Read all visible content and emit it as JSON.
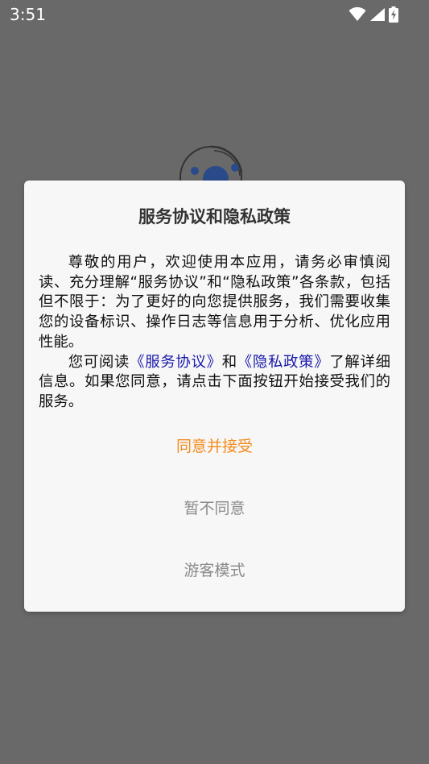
{
  "status_bar": {
    "time": "3:51",
    "icons": [
      "wifi-icon",
      "cellular-signal-icon",
      "battery-charging-icon"
    ]
  },
  "dialog": {
    "title": "服务协议和隐私政策",
    "paragraph1": "尊敬的用户，欢迎使用本应用，请务必审慎阅读、充分理解“服务协议”和“隐私政策”各条款，包括但不限于：为了更好的向您提供服务，我们需要收集您的设备标识、操作日志等信息用于分析、优化应用性能。",
    "paragraph2": {
      "prefix": "您可阅读",
      "service_link": "《服务协议》",
      "middle": "和",
      "privacy_link": "《隐私政策》",
      "suffix": "了解详细信息。如果您同意，请点击下面按钮开始接受我们的服务。"
    },
    "buttons": {
      "agree": "同意并接受",
      "decline": "暂不同意",
      "guest": "游客模式"
    }
  },
  "colors": {
    "overlay": "#696969",
    "dialog_bg": "#f7f7f7",
    "link": "#1a1aaa",
    "accent": "#f28c1e",
    "secondary_button": "#8a8a8a"
  }
}
